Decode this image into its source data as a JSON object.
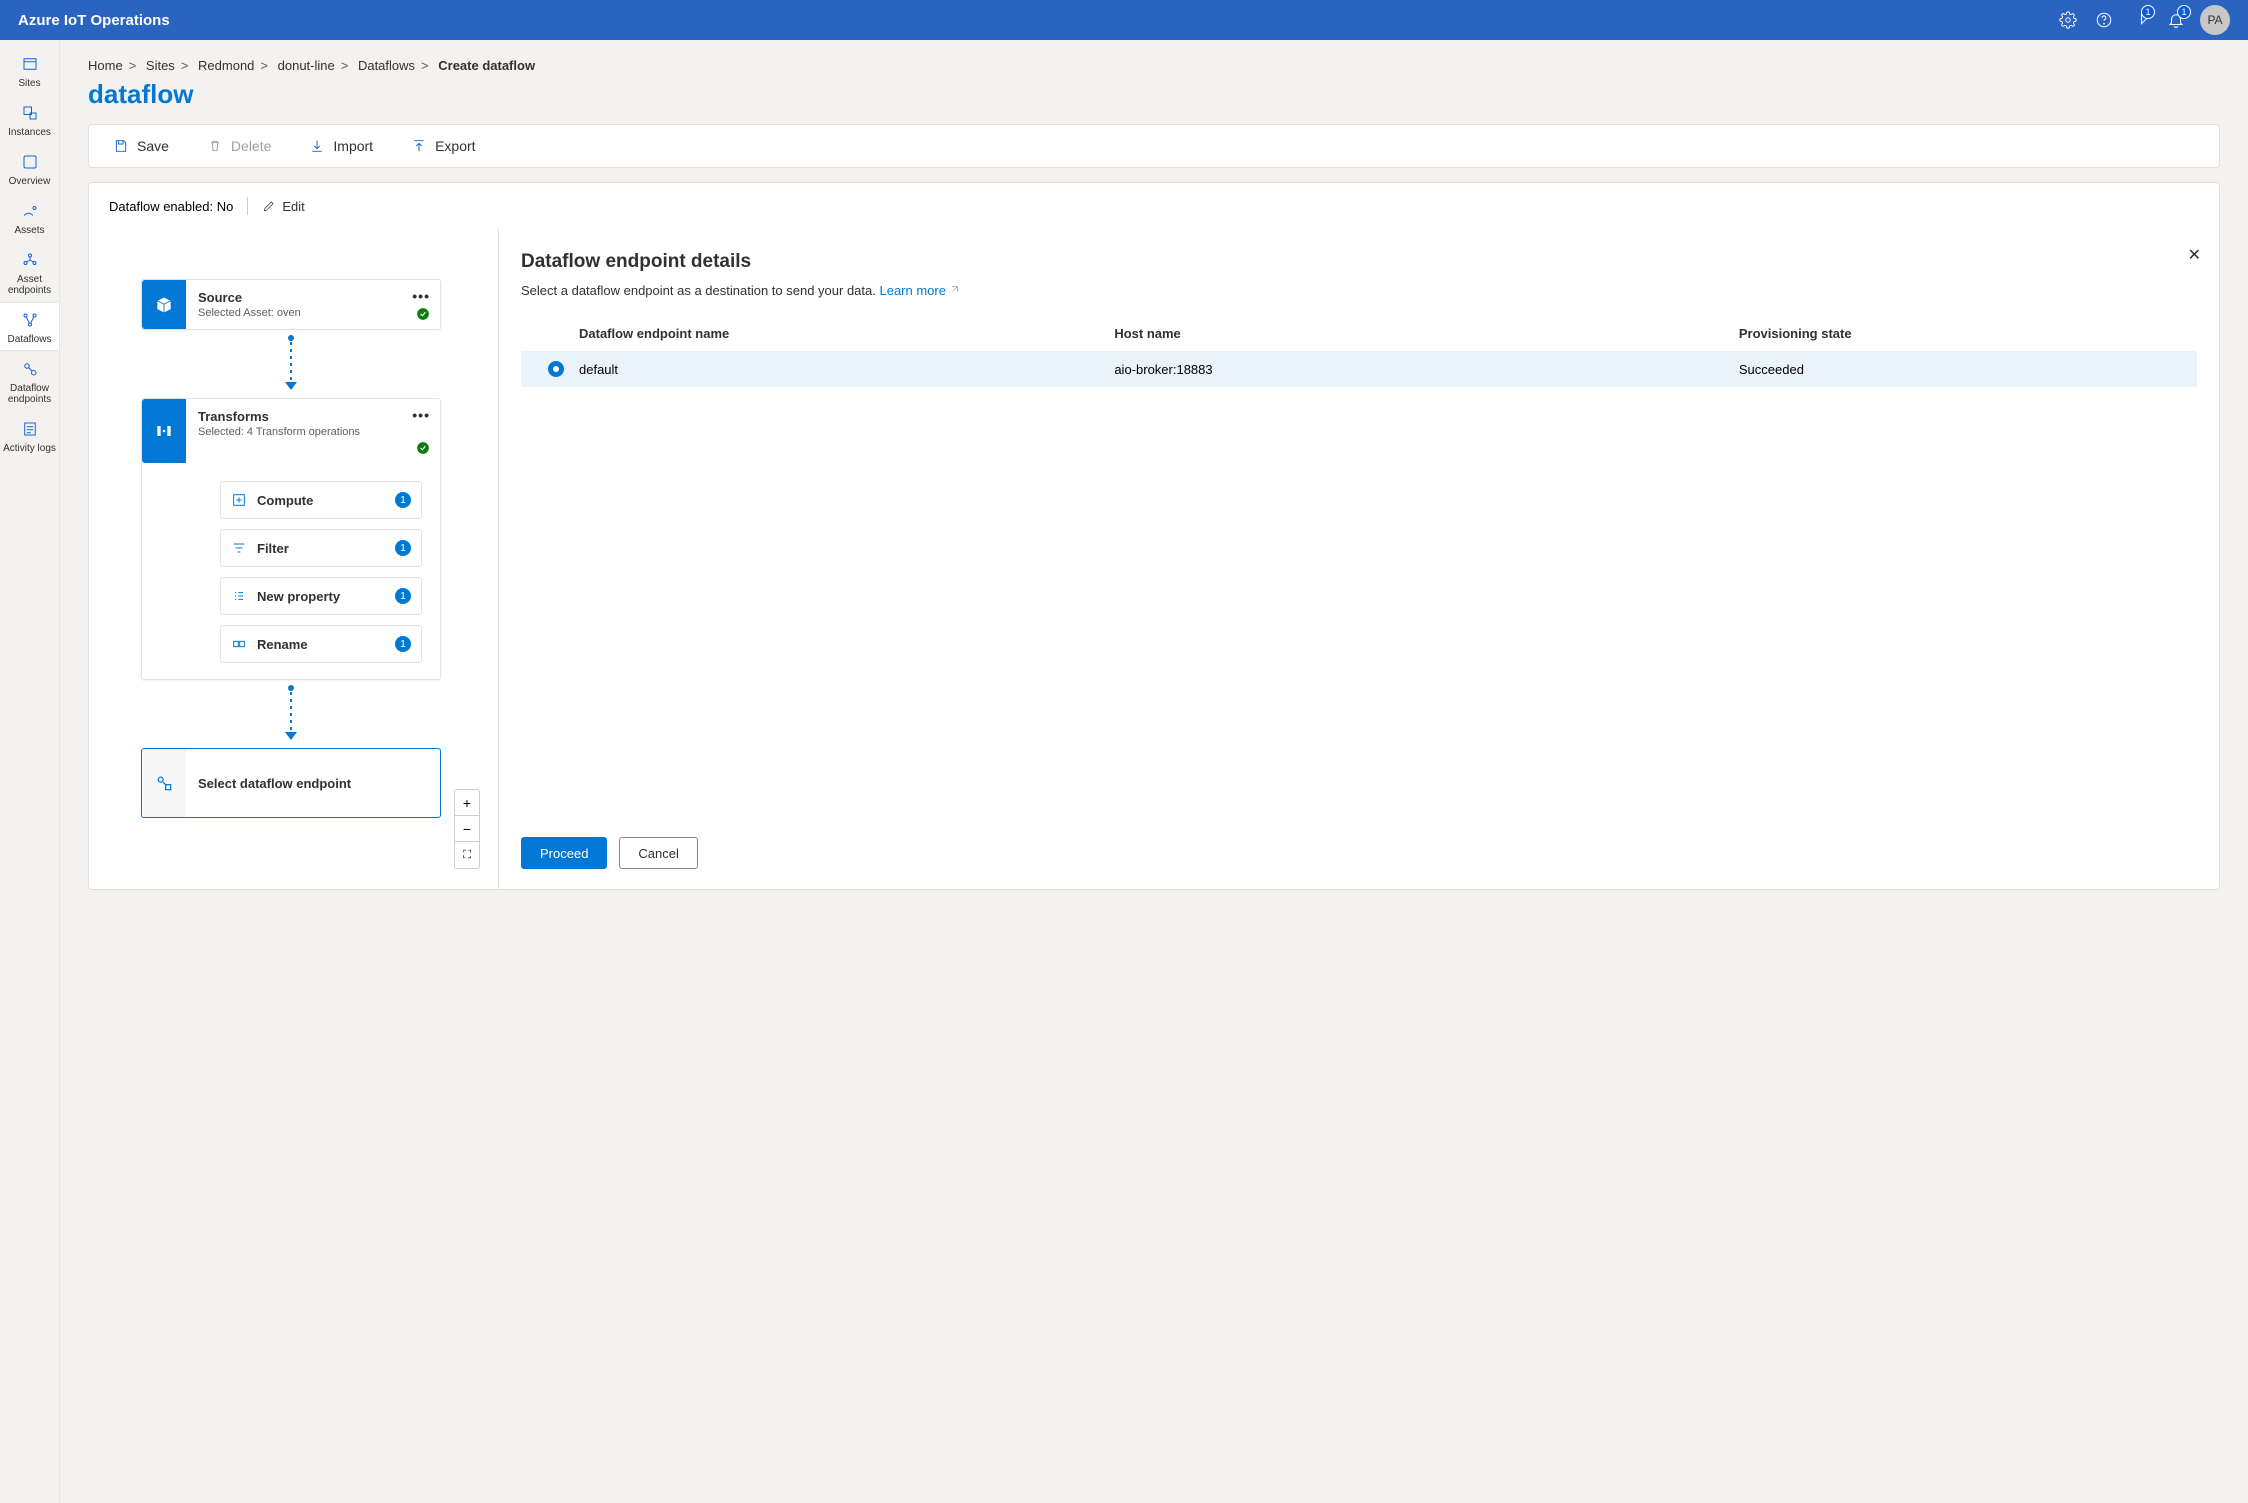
{
  "header": {
    "title": "Azure IoT Operations",
    "notifications_badge": "1",
    "alerts_badge": "1",
    "avatar": "PA"
  },
  "nav": {
    "items": [
      {
        "label": "Sites"
      },
      {
        "label": "Instances"
      },
      {
        "label": "Overview"
      },
      {
        "label": "Assets"
      },
      {
        "label": "Asset endpoints"
      },
      {
        "label": "Dataflows"
      },
      {
        "label": "Dataflow endpoints"
      },
      {
        "label": "Activity logs"
      }
    ]
  },
  "breadcrumb": {
    "items": [
      "Home",
      "Sites",
      "Redmond",
      "donut-line",
      "Dataflows"
    ],
    "current": "Create dataflow"
  },
  "page_title": "dataflow",
  "toolbar": {
    "save": "Save",
    "delete": "Delete",
    "import": "Import",
    "export": "Export"
  },
  "status": {
    "label": "Dataflow enabled:",
    "value": "No",
    "edit": "Edit"
  },
  "canvas": {
    "source": {
      "title": "Source",
      "sub": "Selected Asset: oven"
    },
    "transforms": {
      "title": "Transforms",
      "sub": "Selected: 4 Transform operations",
      "ops": [
        {
          "label": "Compute",
          "count": "1"
        },
        {
          "label": "Filter",
          "count": "1"
        },
        {
          "label": "New property",
          "count": "1"
        },
        {
          "label": "Rename",
          "count": "1"
        }
      ]
    },
    "endpoint": {
      "title": "Select dataflow endpoint"
    }
  },
  "details": {
    "title": "Dataflow endpoint details",
    "desc": "Select a dataflow endpoint as a destination to send your data.",
    "learn_more": "Learn more",
    "table": {
      "headers": {
        "name": "Dataflow endpoint name",
        "host": "Host name",
        "state": "Provisioning state"
      },
      "rows": [
        {
          "name": "default",
          "host": "aio-broker:18883",
          "state": "Succeeded"
        }
      ]
    },
    "proceed": "Proceed",
    "cancel": "Cancel"
  }
}
